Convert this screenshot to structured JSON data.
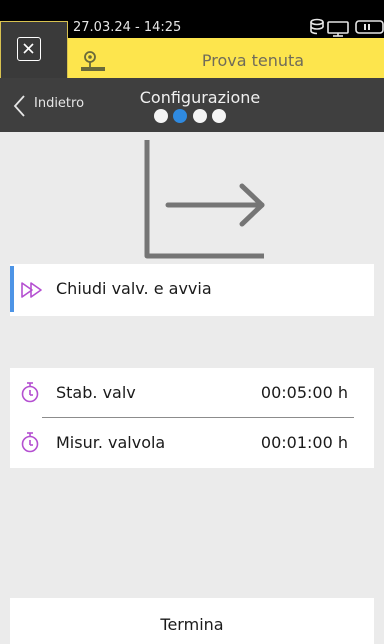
{
  "status_bar": {
    "datetime": "27.03.24 - 14:25"
  },
  "title_bar": {
    "title": "Prova tenuta"
  },
  "nav": {
    "back_label": "Indietro",
    "title": "Configurazione",
    "steps_total": 4,
    "current_step": 2
  },
  "start_row": {
    "label": "Chiudi valv. e avvia"
  },
  "timers": [
    {
      "label": "Stab. valv",
      "value": "00:05:00 h"
    },
    {
      "label": "Misur. valvola",
      "value": "00:01:00 h"
    }
  ],
  "finish_button": {
    "label": "Termina"
  },
  "colors": {
    "header_yellow": "#fde54d",
    "nav_dark": "#3f3f3f",
    "accent_blue": "#2f8ae0",
    "icon_magenta": "#b44fd1"
  },
  "icons": {
    "close": "close-icon",
    "app": "leak-test-icon",
    "database": "database-icon",
    "monitor": "monitor-icon",
    "battery": "battery-icon",
    "back": "chevron-left-icon",
    "start": "play-forward-icon",
    "timer": "stopwatch-icon",
    "illustration": "corner-arrow-icon"
  }
}
